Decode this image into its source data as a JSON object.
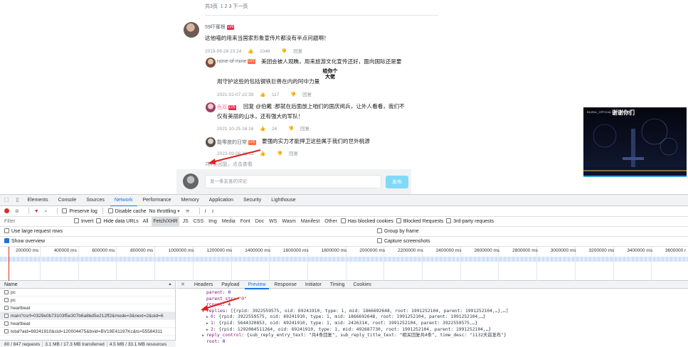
{
  "pager": {
    "total": "共3页",
    "current": "1",
    "pages": "2 3",
    "next": "下一页"
  },
  "comments": {
    "main": {
      "username": "59吓罹根",
      "level": "LV6",
      "text": "这他喵的用来当国家形象宣传片都没有半点问题啊！",
      "time": "2019-09-28 23:24",
      "likes": "1048",
      "reply": "回复"
    },
    "replies": [
      {
        "username": "none-of-mine",
        "level": "LV5",
        "text1": "美团会被人观瞧，用来旅游文化宣传还好，面向国际还是要",
        "text2": "用守护这些的包括钢铁巨兽在内的阿中力量",
        "time": "2021-01-07 22:39",
        "likes": "117",
        "reply": "回复"
      },
      {
        "username": "色双",
        "level": "LV5",
        "text1": "回复 @伯戴 :那就在后面放上咱们的国庆阅兵，让外人看看，我们不",
        "text2": "仅有美丽的山水，还有强大的军队！",
        "time": "2021-10-25 16:16",
        "likes": "24",
        "reply": "回复"
      },
      {
        "username": "能零度的日常",
        "level": "LV5",
        "text1": "要强的实力才能捍卫这些属于我们的世外桃源",
        "time": "2022-09-08 22:12",
        "likes": "",
        "reply": "回复"
      }
    ],
    "more_replies": "共4条回复，点击查看",
    "sticker": "给你个大佬",
    "input_placeholder": "发一条友善的评论",
    "send_label": "发布"
  },
  "video_thumb": {
    "title": "谢谢你们",
    "channel": "BILIBILI_OFFICIAL"
  },
  "devtools": {
    "tabs": [
      "Elements",
      "Console",
      "Sources",
      "Network",
      "Performance",
      "Memory",
      "Application",
      "Security",
      "Lighthouse"
    ],
    "active_tab": "Network",
    "toolbar": {
      "preserve_log": "Preserve log",
      "disable_cache": "Disable cache",
      "throttling": "No throttling"
    },
    "filter": {
      "placeholder": "Filter",
      "invert": "Invert",
      "hide_data_urls": "Hide data URLs",
      "types": [
        "All",
        "Fetch/XHR",
        "JS",
        "CSS",
        "Img",
        "Media",
        "Font",
        "Doc",
        "WS",
        "Wasm",
        "Manifest",
        "Other"
      ],
      "active_type": "Fetch/XHR",
      "has_blocked_cookies": "Has blocked cookies",
      "blocked_requests": "Blocked Requests",
      "third_party": "3rd-party requests"
    },
    "options": {
      "large_rows": "Use large request rows",
      "group_by_frame": "Group by frame",
      "show_overview": "Show overview",
      "capture_screenshots": "Capture screenshots"
    },
    "timeline_ticks": [
      "200000 ms",
      "400000 ms",
      "600000 ms",
      "800000 ms",
      "1000000 ms",
      "1200000 ms",
      "1400000 ms",
      "1600000 ms",
      "1800000 ms",
      "2000000 ms",
      "2200000 ms",
      "2400000 ms",
      "2600000 ms",
      "2800000 ms",
      "3000000 ms",
      "3200000 ms",
      "3400000 ms",
      "3600000 r"
    ],
    "requests": {
      "header": "Name",
      "items": [
        {
          "name": "pc",
          "selected": false
        },
        {
          "name": "pc",
          "selected": false
        },
        {
          "name": "heartbeat",
          "selected": false
        },
        {
          "name": "main?csrf=0329e0b73103f5e307b6a8bd5e212ff2&mode=3&next=2&oid=6",
          "selected": true
        },
        {
          "name": "heartbeat",
          "selected": false
        },
        {
          "name": "total?aid=69241910&cid=120004475&bvid=BV19E41197Kc&ts=55584311",
          "selected": false
        }
      ],
      "status": {
        "requests": "80 / 847 requests",
        "transferred": "3.1 MB / 17.3 MB transferred",
        "resources": "4.5 MB / 33.1 MB resources"
      }
    },
    "detail_tabs": [
      "Headers",
      "Payload",
      "Preview",
      "Response",
      "Initiator",
      "Timing",
      "Cookies"
    ],
    "active_detail_tab": "Preview",
    "preview": {
      "l1k": "parent",
      "l1v": "0",
      "l2k": "parent_str",
      "l2v": "\"0\"",
      "l3k": "rcount",
      "l3v": "4",
      "l4k": "replies",
      "l4v": "[{rpid: 3922559575, oid: 69241910, type: 1, mid: 1866692648, root: 1991252104, parent: 1991252104,…},…]",
      "l5k": "0",
      "l5v": "{rpid: 3922559575, oid: 69241910, type: 1, mid: 1866692648, root: 1991252104, parent: 1991252104,…}",
      "l6k": "1",
      "l6v": "{rpid: 5644320853, oid: 69241910, type: 1, mid: 2426314, root: 1991252104, parent: 3922559575,…}",
      "l7k": "2",
      "l7v": "{rpid: 1292084511264, oid: 69241910, type: 1, mid: 492687730, root: 1991252104, parent: 1991252104,…}",
      "l8k": "reply_control",
      "l8v": "{sub_reply_entry_text: \"共4条回复\", sub_reply_title_text: \"相关回复共4条\", time_desc: \"1132天前发布\"}",
      "l9k": "root",
      "l9v": "0"
    }
  }
}
